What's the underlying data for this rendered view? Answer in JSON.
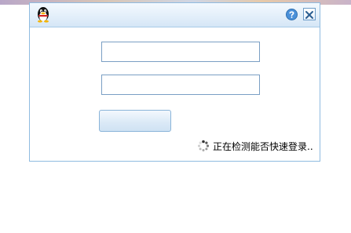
{
  "window": {
    "title": "",
    "icons": {
      "logo": "qq-penguin-icon",
      "help": "help-icon",
      "close": "close-icon"
    }
  },
  "login": {
    "account_value": "",
    "password_value": "",
    "login_button_label": ""
  },
  "status": {
    "icon": "loading-spinner-icon",
    "text": "正在检测能否快速登录.."
  },
  "colors": {
    "titlebar": "#e3effa",
    "window_border": "#8fbbe0",
    "field_border": "#7a9fc4",
    "close_border": "#6d9cc8",
    "help_blue": "#4a90d9"
  }
}
